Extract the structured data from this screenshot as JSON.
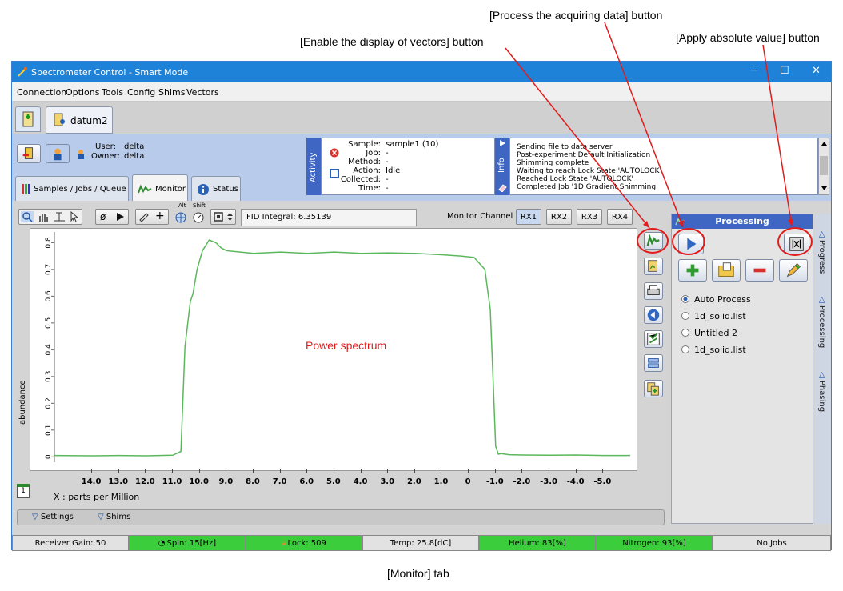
{
  "callouts": {
    "process_data": "[Process the acquiring data] button",
    "enable_vectors": "[Enable the display of vectors] button",
    "apply_abs": "[Apply absolute value] button",
    "power_spectrum": "Power spectrum",
    "monitor_tab": "[Monitor] tab"
  },
  "window": {
    "title": "Spectrometer Control - Smart Mode",
    "min": "─",
    "max": "☐",
    "close": "✕"
  },
  "menu": [
    "Connection",
    "Options",
    "Tools",
    "Config",
    "Shims",
    "Vectors"
  ],
  "doc_tab": "datum2",
  "user": {
    "user_label": "User:",
    "user": "delta",
    "owner_label": "Owner:",
    "owner": "delta"
  },
  "activity": {
    "side": "Activity",
    "sample_label": "Sample:",
    "sample": "sample1  (10)",
    "job_label": "Job:",
    "job": "-",
    "method_label": "Method:",
    "method": "-",
    "action_label": "Action:",
    "action": "Idle",
    "collected_label": "Collected:",
    "collected": "-",
    "time_label": "Time:",
    "time": "-"
  },
  "info": {
    "side": "Info",
    "lines": [
      "Sending file to data server",
      "Post-experiment Default Initialization",
      "Shimming complete",
      "Waiting to reach Lock State 'AUTOLOCK'",
      "Reached Lock State 'AUTOLOCK'",
      "Completed Job '1D Gradient Shimming'"
    ]
  },
  "tabs": {
    "samples": "Samples / Jobs / Queue",
    "monitor": "Monitor",
    "status": "Status"
  },
  "toolbar": {
    "alt": "Alt",
    "shift": "Shift",
    "fid": "FID Integral: 6.35139",
    "monitor_channel": "Monitor Channel",
    "rx": [
      "RX1",
      "RX2",
      "RX3",
      "RX4"
    ]
  },
  "plot": {
    "ylabel": "abundance",
    "xlabel": "X : parts per Million",
    "badge": "1"
  },
  "chart_data": {
    "type": "line",
    "xlabel": "X : parts per Million",
    "ylabel": "abundance",
    "xlim": [
      15.4,
      -6.0
    ],
    "ylim": [
      -0.02,
      0.84
    ],
    "x_ticks": [
      "14.0",
      "13.0",
      "12.0",
      "11.0",
      "10.0",
      "9.0",
      "8.0",
      "7.0",
      "6.0",
      "5.0",
      "4.0",
      "3.0",
      "2.0",
      "1.0",
      "0",
      "-1.0",
      "-2.0",
      "-3.0",
      "-4.0",
      "-5.0"
    ],
    "y_ticks": [
      "0",
      "0.1",
      "0.2",
      "0.3",
      "0.4",
      "0.5",
      "0.6",
      "0.7",
      "0.8"
    ],
    "series": [
      {
        "color": "#5cb85c",
        "x": [
          15.4,
          14.0,
          13.0,
          12.0,
          11.0,
          10.7,
          10.55,
          10.35,
          10.25,
          10.1,
          9.9,
          9.65,
          9.4,
          9.2,
          9.0,
          8.5,
          8.0,
          7.0,
          6.0,
          5.0,
          4.0,
          3.0,
          2.0,
          1.0,
          0.3,
          -0.2,
          -0.6,
          -0.8,
          -0.9,
          -1.0,
          -1.1,
          -1.2,
          -1.5,
          -2.0,
          -3.0,
          -4.0,
          -5.0,
          -6.0
        ],
        "y": [
          0.005,
          0.004,
          0.005,
          0.004,
          0.006,
          0.02,
          0.41,
          0.58,
          0.61,
          0.7,
          0.77,
          0.81,
          0.8,
          0.78,
          0.77,
          0.765,
          0.76,
          0.765,
          0.76,
          0.765,
          0.76,
          0.762,
          0.76,
          0.755,
          0.75,
          0.745,
          0.7,
          0.55,
          0.3,
          0.04,
          0.01,
          0.012,
          0.008,
          0.007,
          0.006,
          0.007,
          0.005,
          0.005
        ]
      }
    ]
  },
  "processing": {
    "title": "Processing",
    "items": [
      {
        "label": "Auto Process",
        "selected": true
      },
      {
        "label": "1d_solid.list",
        "selected": false
      },
      {
        "label": "Untitled 2",
        "selected": false
      },
      {
        "label": "1d_solid.list",
        "selected": false
      }
    ],
    "side_tabs": [
      "Progress",
      "Processing",
      "Phasing"
    ]
  },
  "bottom": {
    "settings": "Settings",
    "shims": "Shims"
  },
  "statusbar": [
    "Receiver Gain: 50",
    "Spin: 15[Hz]",
    "Lock: 509",
    "Temp: 25.8[dC]",
    "Helium: 83[%]",
    "Nitrogen: 93[%]",
    "No Jobs"
  ]
}
